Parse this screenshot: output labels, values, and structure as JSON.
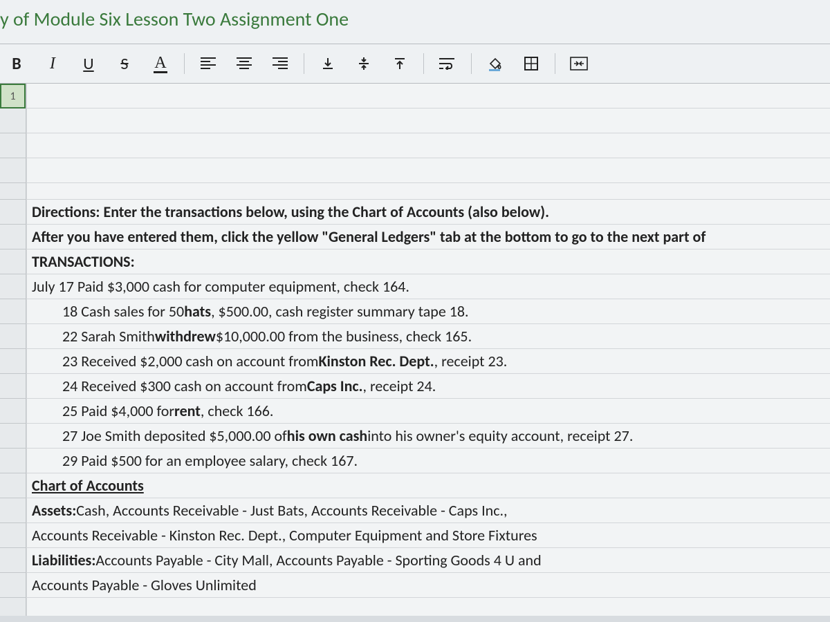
{
  "title": "y of Module Six Lesson Two Assignment One",
  "toolbar": {
    "bold": "B",
    "italic": "I",
    "underline": "U",
    "strike": "S",
    "font_color": "A"
  },
  "rowhead_selected": "1",
  "content": {
    "directions1": "Directions: Enter the transactions below, using the Chart of Accounts (also below).",
    "directions2": "After you have entered them, click the yellow \"General Ledgers\" tab at the bottom to go to the next part of",
    "trans_header": "TRANSACTIONS:",
    "jul17_a": "July 17 Paid $3,000 cash for computer equipment, check 164.",
    "jul18_pre": "18 Cash sales for 50 ",
    "jul18_b": "hats",
    "jul18_post": ", $500.00, cash register summary tape 18.",
    "jul22_pre": "22 Sarah Smith ",
    "jul22_b": "withdrew",
    "jul22_post": " $10,000.00 from the business, check 165.",
    "jul23_pre": "23 Received $2,000 cash on account from ",
    "jul23_b": "Kinston Rec. Dept.",
    "jul23_post": ", receipt 23.",
    "jul24_pre": "24 Received $300 cash on account from ",
    "jul24_b": "Caps Inc.",
    "jul24_post": ", receipt 24.",
    "jul25_pre": "25 Paid $4,000 for ",
    "jul25_b": "rent",
    "jul25_post": ", check 166.",
    "jul27_pre": "27 Joe Smith deposited $5,000.00 of ",
    "jul27_b": "his own cash",
    "jul27_post": " into his owner's equity account, receipt 27.",
    "jul29": "29 Paid $500 for an employee salary, check 167.",
    "coa_header": "Chart of Accounts",
    "assets_label": "Assets:",
    "assets_rest": " Cash, Accounts Receivable - Just Bats, Accounts Receivable - Caps Inc.,",
    "assets_line2": "Accounts Receivable - Kinston Rec. Dept., Computer Equipment and Store Fixtures",
    "liab_label": "Liabilities:",
    "liab_rest": " Accounts Payable - City Mall, Accounts Payable - Sporting Goods 4 U and",
    "liab_line2": "Accounts Payable - Gloves Unlimited"
  }
}
